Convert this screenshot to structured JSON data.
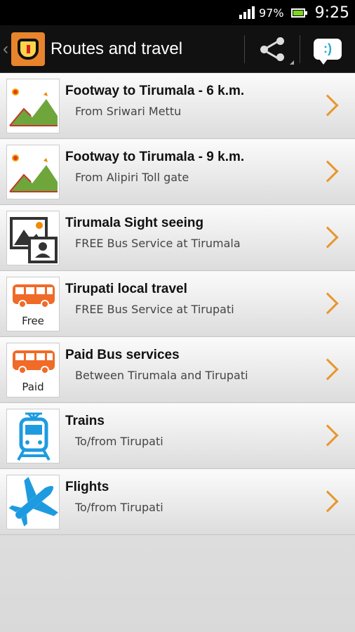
{
  "status_bar": {
    "battery_percent": "97%",
    "time": "9:25",
    "battery_color": "#7ed321"
  },
  "action_bar": {
    "title": "Routes and travel",
    "share_icon": "share-icon",
    "feedback_icon": "feedback-icon"
  },
  "accent_color": "#e8962c",
  "items": [
    {
      "title": "Footway to Tirumala - 6 k.m.",
      "subtitle": "From Sriwari Mettu",
      "icon": "mountain-icon"
    },
    {
      "title": "Footway to Tirumala - 9 k.m.",
      "subtitle": "From Alipiri Toll gate",
      "icon": "mountain-icon"
    },
    {
      "title": "Tirumala Sight seeing",
      "subtitle": "FREE Bus Service at Tirumala",
      "icon": "photo-gallery-icon"
    },
    {
      "title": "Tirupati local travel",
      "subtitle": "FREE Bus Service at Tirupati",
      "icon": "bus-icon",
      "badge": "Free"
    },
    {
      "title": "Paid Bus services",
      "subtitle": "Between Tirumala and Tirupati",
      "icon": "bus-icon",
      "badge": "Paid"
    },
    {
      "title": "Trains",
      "subtitle": "To/from Tirupati",
      "icon": "train-icon"
    },
    {
      "title": "Flights",
      "subtitle": "To/from Tirupati",
      "icon": "airplane-icon"
    }
  ]
}
